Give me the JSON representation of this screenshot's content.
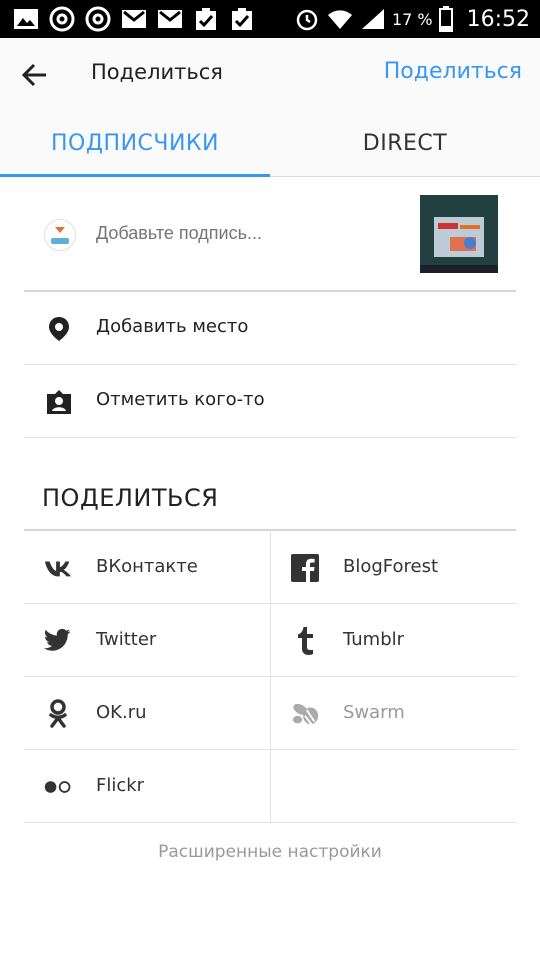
{
  "status_bar": {
    "battery_text": "17 %",
    "time": "16:52",
    "left_icons": [
      "picture-icon",
      "at-icon",
      "at-icon",
      "gmail-icon",
      "gmail-icon",
      "clipboard-check-icon",
      "clipboard-check-icon"
    ],
    "right_icons": [
      "alarm-icon",
      "wifi-icon",
      "signal-icon",
      "battery-icon"
    ]
  },
  "app_bar": {
    "title": "Поделиться",
    "share_action": "Поделиться"
  },
  "tabs": [
    {
      "label": "ПОДПИСЧИКИ",
      "active": true
    },
    {
      "label": "DIRECT",
      "active": false
    }
  ],
  "caption": {
    "placeholder": "Добавьте подпись..."
  },
  "options": [
    {
      "label": "Добавить место",
      "icon": "location-pin-icon"
    },
    {
      "label": "Отметить кого-то",
      "icon": "tag-person-icon"
    }
  ],
  "share_section": {
    "title": "ПОДЕЛИТЬСЯ",
    "services": [
      {
        "label": "ВКонтакте",
        "icon": "vk-icon",
        "enabled": true
      },
      {
        "label": "BlogForest",
        "icon": "facebook-icon",
        "enabled": true
      },
      {
        "label": "Twitter",
        "icon": "twitter-icon",
        "enabled": true
      },
      {
        "label": "Tumblr",
        "icon": "tumblr-icon",
        "enabled": true
      },
      {
        "label": "OK.ru",
        "icon": "odnoklassniki-icon",
        "enabled": true
      },
      {
        "label": "Swarm",
        "icon": "swarm-icon",
        "enabled": false
      },
      {
        "label": "Flickr",
        "icon": "flickr-icon",
        "enabled": true
      }
    ]
  },
  "advanced_settings": "Расширенные настройки",
  "colors": {
    "accent": "#3897f0",
    "text": "#222222",
    "muted": "#999999"
  }
}
